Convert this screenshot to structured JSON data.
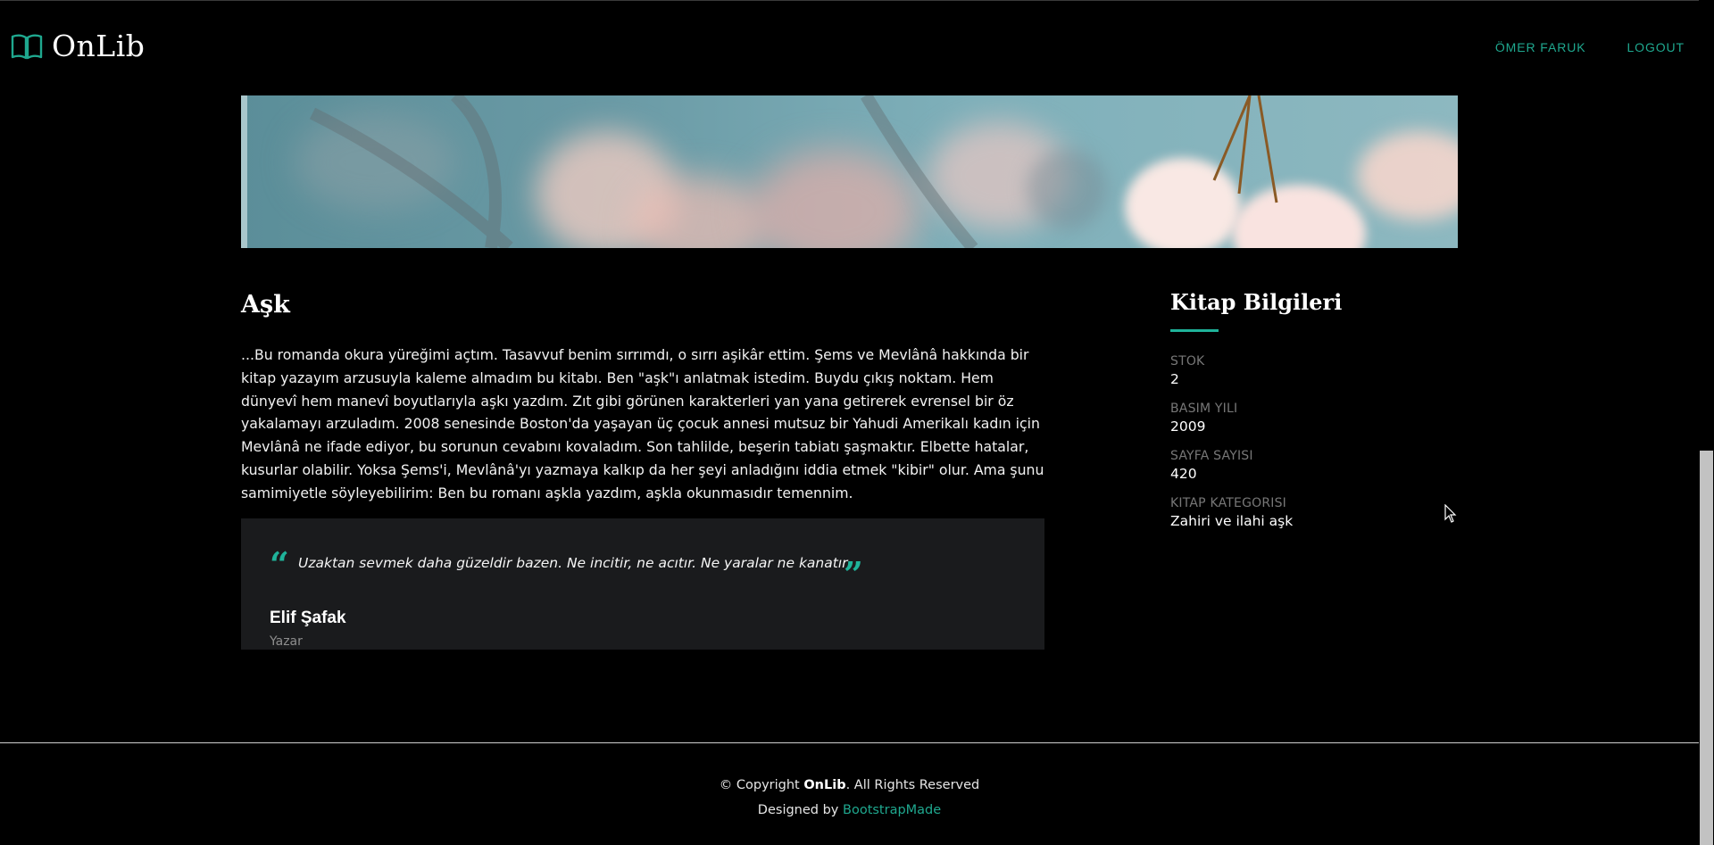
{
  "header": {
    "brand": "OnLib",
    "nav": [
      {
        "label": "ÖMER FARUK"
      },
      {
        "label": "LOGOUT"
      }
    ]
  },
  "book": {
    "title": "Aşk",
    "description": "...Bu romanda okura yüreğimi açtım. Tasavvuf benim sırrımdı, o sırrı aşikâr ettim. Şems ve Mevlânâ hakkında bir kitap yazayım arzusuyla kaleme almadım bu kitabı. Ben \"aşk\"ı anlatmak istedim. Buydu çıkış noktam. Hem dünyevî hem manevî boyutlarıyla aşkı yazdım. Zıt gibi görünen karakterleri yan yana getirerek evrensel bir öz yakalamayı arzuladım. 2008 senesinde Boston'da yaşayan üç çocuk annesi mutsuz bir Yahudi Amerikalı kadın için Mevlânâ ne ifade ediyor, bu sorunun cevabını kovaladım. Son tahlilde, beşerin tabiatı şaşmaktır. Elbette hatalar, kusurlar olabilir. Yoksa Şems'i, Mevlânâ'yı yazmaya kalkıp da her şeyi anladığını iddia etmek \"kibir\" olur. Ama şunu samimiyetle söyleyebilirim: Ben bu romanı aşkla yazdım, aşkla okunmasıdır temennim.",
    "quote": {
      "text": "Uzaktan sevmek daha güzeldir bazen. Ne incitir, ne acıtır. Ne yaralar ne kanatır",
      "author": "Elif Şafak",
      "role": "Yazar"
    }
  },
  "sidebar": {
    "title": "Kitap Bilgileri",
    "items": [
      {
        "label": "STOK",
        "value": "2"
      },
      {
        "label": "BASIM YILI",
        "value": "2009"
      },
      {
        "label": "SAYFA SAYISI",
        "value": "420"
      },
      {
        "label": "KITAP KATEGORISI",
        "value": "Zahiri ve ilahi aşk"
      }
    ]
  },
  "footer": {
    "copyright_prefix": "© Copyright ",
    "brand": "OnLib",
    "copyright_suffix": ". All Rights Reserved",
    "designed_by": "Designed by ",
    "designer": "BootstrapMade"
  },
  "colors": {
    "accent": "#1fa88f",
    "background": "#000000",
    "quote_bg": "#1a1b1d"
  }
}
